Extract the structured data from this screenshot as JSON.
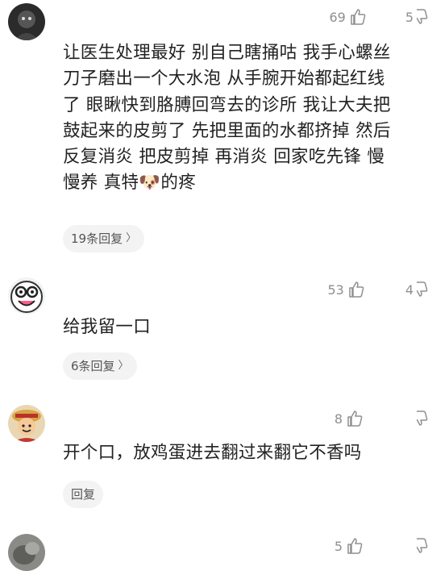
{
  "comments": [
    {
      "likes": "69",
      "dislikes": "5",
      "text": "让医生处理最好 别自己瞎捅咕 我手心螺丝\n刀子磨出一个大水泡 从手腕开始都起红线\n了 眼瞅快到胳膊回弯去的诊所 我让大夫把\n鼓起来的皮剪了 先把里面的水都挤掉 然后\n反复消炎 把皮剪掉 再消炎 回家吃先锋 慢\n慢养 真特🐶的疼",
      "reply_label": "19条回复",
      "avatar_icon": "dark-photo-avatar"
    },
    {
      "likes": "53",
      "dislikes": "4",
      "text": "给我留一口",
      "reply_label": "6条回复",
      "avatar_icon": "cartoon-face-avatar"
    },
    {
      "likes": "8",
      "dislikes": "",
      "text": "开个口，放鸡蛋进去翻过来翻它不香吗",
      "reply_label": "回复",
      "avatar_icon": "anime-character-avatar"
    },
    {
      "likes": "5",
      "dislikes": "",
      "text": "",
      "reply_label": "",
      "avatar_icon": "gray-photo-avatar"
    }
  ],
  "colors": {
    "meta": "#8f8f8f",
    "reply_bg": "#f3f3f3"
  }
}
